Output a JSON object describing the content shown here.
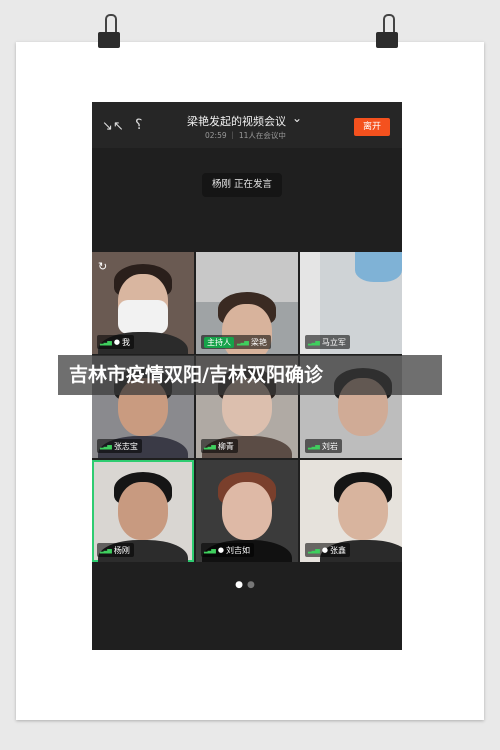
{
  "meeting": {
    "title": "梁艳发起的视频会议",
    "status": "02:59 ｜ 11人在会议中",
    "leave_label": "离开",
    "speaking_text": "杨刚 正在发言"
  },
  "participants": [
    {
      "name": "我",
      "host_badge": "",
      "mic": true
    },
    {
      "name": "梁艳",
      "host_badge": "主持人",
      "mic": false
    },
    {
      "name": "马立军",
      "host_badge": "",
      "mic": false
    },
    {
      "name": "张志宝",
      "host_badge": "",
      "mic": false
    },
    {
      "name": "柳青",
      "host_badge": "",
      "mic": false
    },
    {
      "name": "刘岩",
      "host_badge": "",
      "mic": false
    },
    {
      "name": "杨刚",
      "host_badge": "",
      "mic": false
    },
    {
      "name": "刘吉如",
      "host_badge": "",
      "mic": true
    },
    {
      "name": "张鑫",
      "host_badge": "",
      "mic": true
    }
  ],
  "pager": {
    "pages": 2,
    "current": 1
  },
  "caption": "吉林市疫情双阳/吉林双阳确诊",
  "icons": {
    "shrink": "shrink-icon",
    "earpiece": "ear-icon",
    "switch_camera": "camera-switch-icon",
    "signal": "signal-icon",
    "microphone": "mic-icon"
  },
  "colors": {
    "leave": "#f4511e",
    "host_badge": "#16a34a",
    "signal": "#3fcf5e",
    "active_speaker_border": "#2ecc71"
  }
}
